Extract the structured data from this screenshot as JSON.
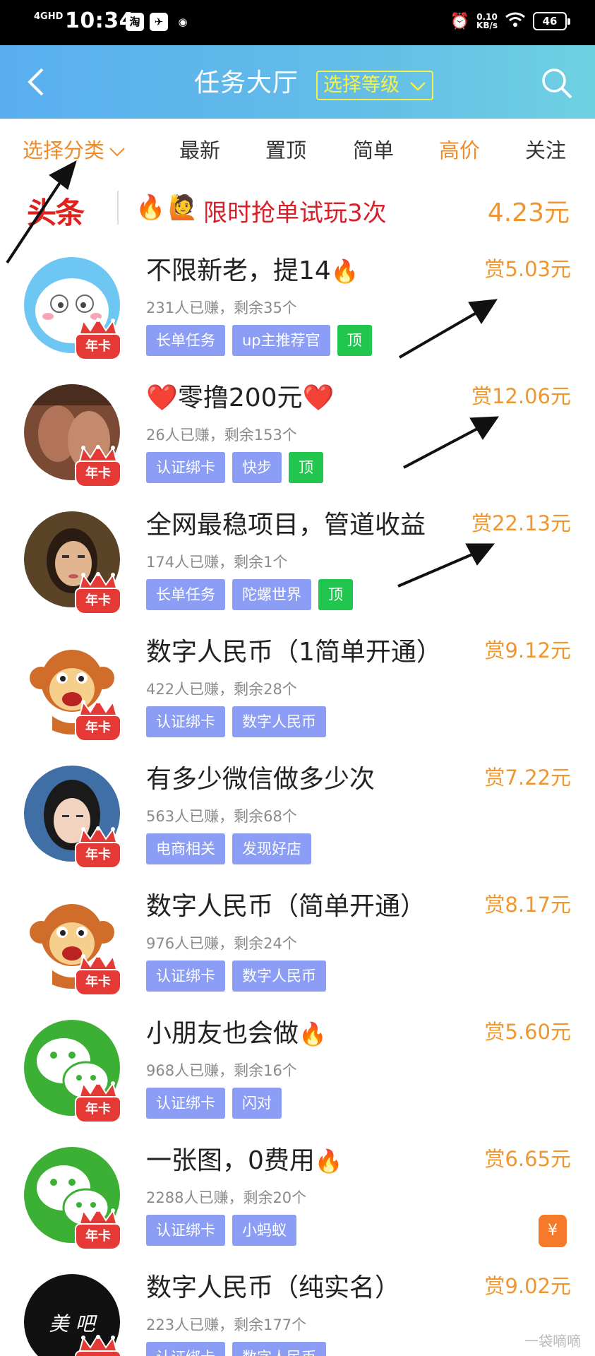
{
  "status_bar": {
    "network": "4GHD",
    "time": "10:34",
    "app_icons": [
      "淘",
      "telegram-icon",
      "weibo-icon"
    ],
    "speed": "0.10",
    "speed_unit": "KB/s",
    "battery": "46"
  },
  "header": {
    "title": "任务大厅",
    "level_button": "选择等级"
  },
  "tabs": [
    {
      "label": "选择分类",
      "active": true
    },
    {
      "label": "最新"
    },
    {
      "label": "置顶"
    },
    {
      "label": "简单"
    },
    {
      "label": "高价",
      "highlight": true
    },
    {
      "label": "关注"
    }
  ],
  "banner": {
    "logo": "头条",
    "text": "限时抢单试玩3次",
    "price": "4.23元"
  },
  "badge_label": "年卡",
  "tasks": [
    {
      "title": "不限新老，提14",
      "fire": true,
      "stats": "231人已赚，剩余35个",
      "tags": [
        "长单任务",
        "up主推荐官"
      ],
      "pinned": "顶",
      "reward": "赏5.03元",
      "avatar": "cartoon-face"
    },
    {
      "title": "❤️零撸200元❤️",
      "stats": "26人已赚，剩余153个",
      "tags": [
        "认证绑卡",
        "快步"
      ],
      "pinned": "顶",
      "reward": "赏12.06元",
      "avatar": "photo-brown"
    },
    {
      "title": "全网最稳项目，管道收益",
      "stats": "174人已赚，剩余1个",
      "tags": [
        "长单任务",
        "陀螺世界"
      ],
      "pinned": "顶",
      "reward": "赏22.13元",
      "avatar": "photo-woman"
    },
    {
      "title": "数字人民币（1简单开通）",
      "stats": "422人已赚，剩余28个",
      "tags": [
        "认证绑卡",
        "数字人民币"
      ],
      "reward": "赏9.12元",
      "avatar": "monkey"
    },
    {
      "title": "有多少微信做多少次",
      "stats": "563人已赚，剩余68个",
      "tags": [
        "电商相关",
        "发现好店"
      ],
      "reward": "赏7.22元",
      "avatar": "photo-girl"
    },
    {
      "title": "数字人民币（简单开通）",
      "stats": "976人已赚，剩余24个",
      "tags": [
        "认证绑卡",
        "数字人民币"
      ],
      "reward": "赏8.17元",
      "avatar": "monkey"
    },
    {
      "title": "小朋友也会做",
      "fire": true,
      "stats": "968人已赚，剩余16个",
      "tags": [
        "认证绑卡",
        "闪对"
      ],
      "reward": "赏5.60元",
      "avatar": "wechat"
    },
    {
      "title": "一张图，0费用",
      "fire": true,
      "stats": "2288人已赚，剩余20个",
      "tags": [
        "认证绑卡",
        "小蚂蚁"
      ],
      "reward": "赏6.65元",
      "avatar": "wechat",
      "wallet": "¥"
    },
    {
      "title": "数字人民币（纯实名）",
      "stats": "223人已赚，剩余177个",
      "tags": [
        "认证绑卡",
        "数字人民币"
      ],
      "reward": "赏9.02元",
      "avatar": "meiba",
      "avatar_text": "美 吧"
    }
  ],
  "colors": {
    "header_gradient_start": "#5aaef0",
    "header_gradient_end": "#6fd0e2",
    "accent_orange": "#f0962f",
    "tag_blue": "#8b9df5",
    "tag_green": "#21c64e",
    "banner_red": "#d8202a",
    "level_yellow": "#f6f04a"
  },
  "watermark": "一袋嘀嘀"
}
